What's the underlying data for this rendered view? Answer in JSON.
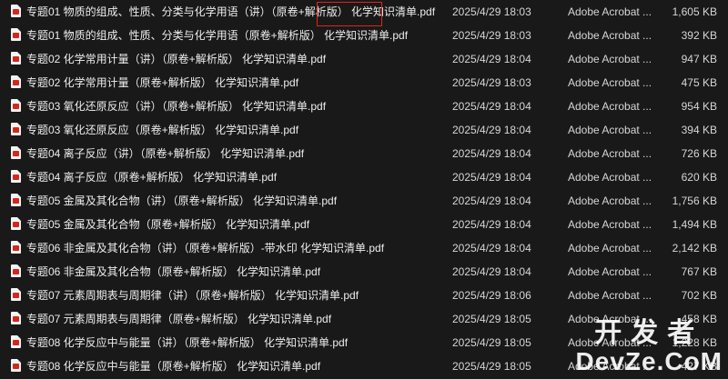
{
  "files": [
    {
      "name": "专题01 物质的组成、性质、分类与化学用语（讲）（原卷+解析版） 化学知识清单.pdf",
      "date": "2025/4/29 18:03",
      "type": "Adobe Acrobat ...",
      "size": "1,605 KB"
    },
    {
      "name": "专题01 物质的组成、性质、分类与化学用语（原卷+解析版） 化学知识清单.pdf",
      "date": "2025/4/29 18:03",
      "type": "Adobe Acrobat ...",
      "size": "392 KB"
    },
    {
      "name": "专题02 化学常用计量（讲）（原卷+解析版） 化学知识清单.pdf",
      "date": "2025/4/29 18:04",
      "type": "Adobe Acrobat ...",
      "size": "947 KB"
    },
    {
      "name": "专题02 化学常用计量（原卷+解析版） 化学知识清单.pdf",
      "date": "2025/4/29 18:03",
      "type": "Adobe Acrobat ...",
      "size": "475 KB"
    },
    {
      "name": "专题03 氧化还原反应（讲）（原卷+解析版） 化学知识清单.pdf",
      "date": "2025/4/29 18:04",
      "type": "Adobe Acrobat ...",
      "size": "954 KB"
    },
    {
      "name": "专题03 氧化还原反应（原卷+解析版） 化学知识清单.pdf",
      "date": "2025/4/29 18:04",
      "type": "Adobe Acrobat ...",
      "size": "394 KB"
    },
    {
      "name": "专题04 离子反应（讲）（原卷+解析版） 化学知识清单.pdf",
      "date": "2025/4/29 18:04",
      "type": "Adobe Acrobat ...",
      "size": "726 KB"
    },
    {
      "name": "专题04 离子反应（原卷+解析版） 化学知识清单.pdf",
      "date": "2025/4/29 18:04",
      "type": "Adobe Acrobat ...",
      "size": "620 KB"
    },
    {
      "name": "专题05 金属及其化合物（讲）（原卷+解析版） 化学知识清单.pdf",
      "date": "2025/4/29 18:04",
      "type": "Adobe Acrobat ...",
      "size": "1,756 KB"
    },
    {
      "name": "专题05 金属及其化合物（原卷+解析版） 化学知识清单.pdf",
      "date": "2025/4/29 18:04",
      "type": "Adobe Acrobat ...",
      "size": "1,494 KB"
    },
    {
      "name": "专题06 非金属及其化合物（讲）（原卷+解析版）-带水印 化学知识清单.pdf",
      "date": "2025/4/29 18:04",
      "type": "Adobe Acrobat ...",
      "size": "2,142 KB"
    },
    {
      "name": "专题06 非金属及其化合物（原卷+解析版） 化学知识清单.pdf",
      "date": "2025/4/29 18:04",
      "type": "Adobe Acrobat ...",
      "size": "767 KB"
    },
    {
      "name": "专题07 元素周期表与周期律（讲）（原卷+解析版） 化学知识清单.pdf",
      "date": "2025/4/29 18:06",
      "type": "Adobe Acrobat ...",
      "size": "702 KB"
    },
    {
      "name": "专题07 元素周期表与周期律（原卷+解析版） 化学知识清单.pdf",
      "date": "2025/4/29 18:05",
      "type": "Adobe Acrobat ...",
      "size": "458 KB"
    },
    {
      "name": "专题08 化学反应中与能量（讲）（原卷+解析版） 化学知识清单.pdf",
      "date": "2025/4/29 18:05",
      "type": "Adobe Acrobat ...",
      "size": "1,228 KB"
    },
    {
      "name": "专题08 化学反应中与能量（原卷+解析版） 化学知识清单.pdf",
      "date": "2025/4/29 18:05",
      "type": "Adobe Acrobat ...",
      "size": "427 KB"
    }
  ],
  "icon": "pdf-file-icon",
  "accent_color": "#e0241c",
  "watermark": {
    "top": "开发者",
    "bottom": "DevZe.CoM"
  }
}
